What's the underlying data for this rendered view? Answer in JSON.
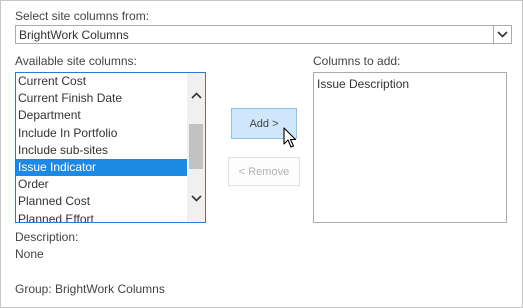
{
  "select_from": {
    "label": "Select site columns from:",
    "value": "BrightWork Columns",
    "arrow_icon": "chevron-down-icon"
  },
  "available": {
    "label": "Available site columns:",
    "items": [
      "Current Cost",
      "Current Finish Date",
      "Department",
      "Include In Portfolio",
      "Include sub-sites",
      "Issue Indicator",
      "Order",
      "Planned Cost",
      "Planned Effort"
    ],
    "selected_index": 5,
    "selected_color": "#1e88e5"
  },
  "buttons": {
    "add_label": "Add >",
    "remove_label": "< Remove"
  },
  "to_add": {
    "label": "Columns to add:",
    "items": [
      "Issue Description"
    ]
  },
  "description": {
    "label": "Description:",
    "value": "None"
  },
  "group": {
    "text": "Group: BrightWork Columns"
  }
}
